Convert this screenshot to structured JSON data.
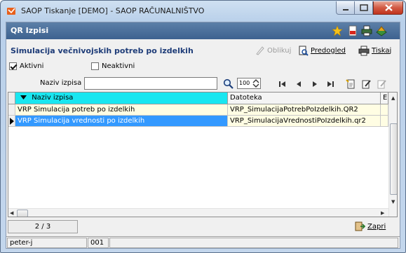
{
  "window": {
    "title": "SAOP Tiskanje [DEMO] - SAOP RAČUNALNIŠTVO"
  },
  "panel": {
    "title": "QR Izpisi"
  },
  "form": {
    "title": "Simulacija večnivojskih potreb po izdelkih"
  },
  "toolbar": {
    "oblikuj": "Oblikuj",
    "predogled": "Predogled",
    "tiskaj": "Tiskaj"
  },
  "filters": {
    "aktivni": {
      "label": "Aktivni",
      "checked": true
    },
    "neaktivni": {
      "label": "Neaktivni",
      "checked": false
    }
  },
  "search": {
    "label": "Naziv izpisa",
    "value": ""
  },
  "zoom": "100",
  "grid": {
    "columns": [
      "Naziv izpisa",
      "Datoteka",
      "E"
    ],
    "rows": [
      {
        "naziv": "VRP Simulacija potreb po izdelkih",
        "datoteka": "VRP_SimulacijaPotrebPoIzdelkih.QR2"
      },
      {
        "naziv": "VRP Simulacija vrednosti po izdelkih",
        "datoteka": "VRP_SimulacijaVrednostiPoIzdelkih.qr2"
      }
    ]
  },
  "footer": {
    "counter": "2 / 3",
    "close_label": "Zapri"
  },
  "statusbar": {
    "user": "peter-j",
    "code": "001"
  },
  "colors": {
    "header_gradient": "#3d6290",
    "selected_row": "#3399ff",
    "sort_column": "#19e6f0",
    "row_background": "#fffde3"
  }
}
